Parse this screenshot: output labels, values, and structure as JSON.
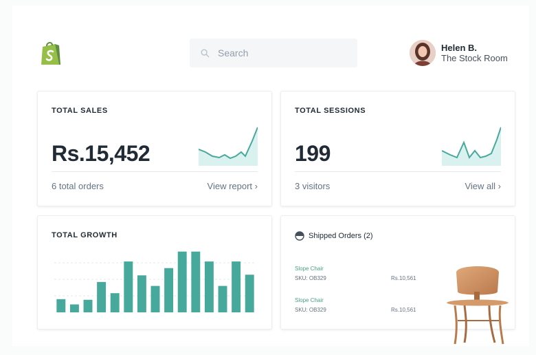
{
  "header": {
    "search_placeholder": "Search",
    "user_name": "Helen B.",
    "store_name": "The Stock Room"
  },
  "cards": {
    "sales": {
      "title": "TOTAL SALES",
      "value": "Rs.15,452",
      "subtext": "6 total orders",
      "link": "View report ›"
    },
    "sessions": {
      "title": "TOTAL SESSIONS",
      "value": "199",
      "subtext": "3 visitors",
      "link": "View all ›"
    },
    "growth": {
      "title": "TOTAL GROWTH"
    },
    "shipped": {
      "title": "Shipped Orders (2)",
      "items": [
        {
          "name": "Slope Chair",
          "sku": "SKU: OB329",
          "price": "Rs.10,561"
        },
        {
          "name": "Slope Chair",
          "sku": "SKU: OB329",
          "price": "Rs.10,561"
        }
      ]
    }
  },
  "chart_data": {
    "type": "bar",
    "title": "TOTAL GROWTH",
    "values": [
      20,
      12,
      19,
      46,
      29,
      77,
      56,
      40,
      67,
      92,
      92,
      77,
      40,
      77,
      57
    ],
    "ylim": [
      0,
      100
    ],
    "color": "#47a99b"
  },
  "colors": {
    "accent": "#47a99b",
    "brand": "#95bf47",
    "sparkline_fill": "#d9f2ef"
  },
  "icons": {
    "logo": "shopify-bag-icon",
    "search": "search-icon",
    "shipped": "half-circle-status-icon"
  }
}
